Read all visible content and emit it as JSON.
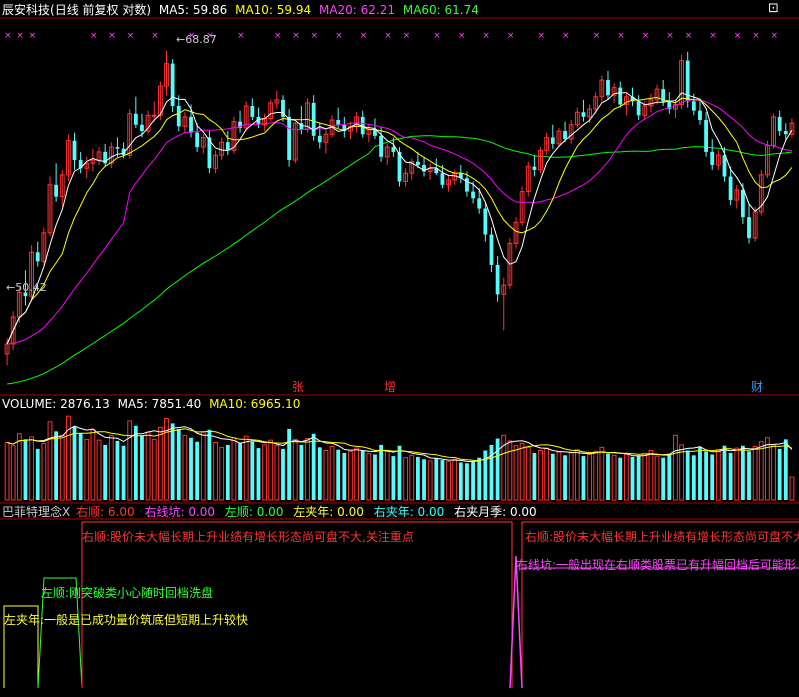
{
  "title_bar": {
    "stock_name": "辰安科技",
    "mode": "(日线 前复权 对数)",
    "ma5": "MA5: 59.86",
    "ma10": "MA10: 59.94",
    "ma20": "MA20: 62.21",
    "ma60": "MA60: 61.74"
  },
  "price_panel": {
    "high_marker": "68.87",
    "low_marker": "50.42",
    "event_markers": [
      {
        "label": "张",
        "color": "#ff3333"
      },
      {
        "label": "增",
        "color": "#ff3333"
      },
      {
        "label": "财",
        "color": "#3399ff"
      }
    ]
  },
  "volume_bar": {
    "volume": "VOLUME: 2876.13",
    "ma5": "MA5: 7851.40",
    "ma10": "MA10: 6965.10"
  },
  "indicator_bar": {
    "name": "巴菲特理念X",
    "items": [
      {
        "label": "右顺: 6.00",
        "color": "#ff3333"
      },
      {
        "label": "右线坑: 0.00",
        "color": "#ff33ff"
      },
      {
        "label": "左顺: 0.00",
        "color": "#33ff33"
      },
      {
        "label": "左夹年: 0.00",
        "color": "#ffff33"
      },
      {
        "label": "右夹年: 0.00",
        "color": "#33ffff"
      },
      {
        "label": "右夹月季: 0.00",
        "color": "#ffffff"
      }
    ]
  },
  "indicator_text": {
    "right_shun_1": "右顺:股价未大幅长期上升业绩有增长形态尚可盘不大,关注重点",
    "right_shun_2": "右顺:股价未大幅长期上升业绩有增长形态尚可盘不大",
    "left_shun": "左顺:刚突破类小心随时回档洗盘",
    "left_jia": "左夹年:一般是已成功量价筑底但短期上升较快",
    "right_pit": "右线坑:一般出现在右顺类股票已有升幅回档后可能形"
  },
  "colors": {
    "up": "#ff3232",
    "down": "#54fcfc",
    "ma5": "#ffffff",
    "ma10": "#ffff00",
    "ma20": "#ff00ff",
    "ma60": "#00ff00",
    "border": "#b00000"
  },
  "chart_data": {
    "type": "candlestick",
    "scale": "log",
    "ylim": [
      49.5,
      71
    ],
    "note_days": 129,
    "ohlc": [
      [
        51.0,
        51.8,
        50.42,
        51.5
      ],
      [
        51.5,
        53.2,
        51.2,
        52.9
      ],
      [
        52.9,
        54.5,
        52.6,
        54.2
      ],
      [
        54.2,
        55.4,
        53.5,
        54.0
      ],
      [
        54.0,
        56.8,
        53.8,
        56.4
      ],
      [
        56.4,
        57.0,
        55.6,
        55.9
      ],
      [
        55.9,
        57.8,
        55.7,
        57.5
      ],
      [
        57.5,
        60.8,
        57.3,
        60.3
      ],
      [
        60.3,
        61.6,
        59.3,
        59.6
      ],
      [
        59.6,
        61.2,
        59.0,
        60.9
      ],
      [
        60.9,
        63.4,
        60.5,
        63.0
      ],
      [
        63.0,
        63.5,
        61.2,
        61.8
      ],
      [
        61.8,
        62.3,
        61.0,
        61.3
      ],
      [
        61.3,
        62.0,
        60.7,
        61.6
      ],
      [
        61.6,
        62.5,
        61.1,
        61.8
      ],
      [
        61.8,
        62.6,
        61.5,
        62.3
      ],
      [
        62.3,
        62.8,
        61.4,
        61.6
      ],
      [
        61.6,
        62.9,
        61.3,
        62.6
      ],
      [
        62.6,
        63.2,
        62.0,
        62.5
      ],
      [
        62.5,
        62.9,
        61.9,
        62.1
      ],
      [
        62.1,
        65.0,
        61.9,
        64.7
      ],
      [
        64.7,
        65.8,
        63.8,
        64.0
      ],
      [
        64.0,
        64.7,
        63.2,
        63.6
      ],
      [
        63.6,
        64.9,
        63.4,
        64.6
      ],
      [
        64.6,
        65.5,
        64.2,
        64.6
      ],
      [
        64.6,
        66.8,
        64.3,
        66.5
      ],
      [
        66.5,
        68.87,
        65.9,
        68.0
      ],
      [
        68.0,
        68.3,
        64.8,
        65.2
      ],
      [
        65.2,
        65.9,
        63.6,
        63.9
      ],
      [
        63.9,
        64.8,
        63.5,
        64.5
      ],
      [
        64.5,
        65.3,
        63.2,
        63.5
      ],
      [
        63.5,
        64.1,
        62.3,
        62.6
      ],
      [
        62.6,
        63.4,
        62.2,
        63.2
      ],
      [
        63.2,
        63.6,
        61.0,
        61.3
      ],
      [
        61.3,
        62.4,
        61.0,
        62.1
      ],
      [
        62.1,
        63.2,
        61.8,
        62.9
      ],
      [
        62.9,
        63.6,
        62.1,
        62.4
      ],
      [
        62.4,
        64.5,
        62.2,
        64.2
      ],
      [
        64.2,
        64.9,
        63.5,
        63.8
      ],
      [
        63.8,
        65.5,
        63.6,
        65.2
      ],
      [
        65.2,
        65.7,
        64.3,
        64.5
      ],
      [
        64.5,
        65.1,
        63.8,
        64.0
      ],
      [
        64.0,
        64.7,
        63.6,
        64.4
      ],
      [
        64.4,
        65.6,
        64.2,
        65.4
      ],
      [
        65.4,
        66.2,
        65.0,
        65.6
      ],
      [
        65.6,
        65.9,
        64.2,
        64.5
      ],
      [
        64.5,
        65.0,
        61.4,
        61.8
      ],
      [
        61.8,
        64.2,
        61.6,
        64.1
      ],
      [
        64.1,
        65.2,
        63.4,
        63.7
      ],
      [
        63.7,
        65.7,
        63.5,
        65.4
      ],
      [
        65.4,
        65.9,
        63.0,
        63.3
      ],
      [
        63.3,
        64.1,
        62.5,
        62.9
      ],
      [
        62.9,
        63.7,
        62.2,
        63.4
      ],
      [
        63.4,
        64.6,
        63.2,
        64.3
      ],
      [
        64.3,
        65.1,
        63.8,
        64.0
      ],
      [
        64.0,
        64.5,
        63.2,
        63.6
      ],
      [
        63.6,
        64.2,
        63.1,
        63.9
      ],
      [
        63.9,
        64.8,
        63.5,
        64.5
      ],
      [
        64.5,
        64.9,
        63.2,
        63.4
      ],
      [
        63.4,
        64.0,
        62.9,
        63.7
      ],
      [
        63.7,
        64.4,
        63.1,
        63.3
      ],
      [
        63.3,
        63.9,
        61.7,
        62.0
      ],
      [
        62.0,
        62.8,
        61.5,
        62.6
      ],
      [
        62.6,
        63.2,
        62.0,
        62.3
      ],
      [
        62.3,
        62.6,
        60.2,
        60.5
      ],
      [
        60.5,
        61.3,
        60.2,
        61.0
      ],
      [
        61.0,
        61.9,
        60.6,
        61.7
      ],
      [
        61.7,
        62.3,
        61.3,
        61.5
      ],
      [
        61.5,
        62.0,
        60.8,
        61.1
      ],
      [
        61.1,
        61.6,
        60.6,
        61.3
      ],
      [
        61.3,
        61.9,
        60.9,
        61.0
      ],
      [
        61.0,
        61.5,
        60.1,
        60.3
      ],
      [
        60.3,
        60.9,
        59.9,
        60.6
      ],
      [
        60.6,
        61.2,
        60.3,
        61.0
      ],
      [
        61.0,
        61.5,
        60.4,
        60.7
      ],
      [
        60.7,
        61.1,
        59.6,
        59.9
      ],
      [
        59.9,
        60.5,
        59.2,
        59.5
      ],
      [
        59.5,
        60.1,
        58.6,
        58.9
      ],
      [
        58.9,
        59.2,
        57.0,
        57.4
      ],
      [
        57.4,
        57.8,
        55.3,
        55.7
      ],
      [
        55.7,
        56.2,
        53.7,
        54.1
      ],
      [
        54.1,
        55.0,
        52.2,
        54.6
      ],
      [
        54.6,
        57.2,
        54.4,
        56.9
      ],
      [
        56.9,
        58.4,
        56.6,
        58.1
      ],
      [
        58.1,
        60.2,
        57.9,
        59.9
      ],
      [
        59.9,
        61.7,
        59.6,
        61.4
      ],
      [
        61.4,
        62.1,
        60.8,
        61.2
      ],
      [
        61.2,
        62.6,
        61.0,
        62.4
      ],
      [
        62.4,
        63.5,
        62.1,
        63.2
      ],
      [
        63.2,
        64.0,
        62.5,
        62.8
      ],
      [
        62.8,
        63.8,
        62.6,
        63.6
      ],
      [
        63.6,
        64.2,
        62.9,
        63.1
      ],
      [
        63.1,
        64.3,
        62.8,
        64.0
      ],
      [
        64.0,
        65.1,
        63.8,
        64.8
      ],
      [
        64.8,
        65.6,
        64.2,
        64.5
      ],
      [
        64.5,
        65.3,
        64.1,
        65.0
      ],
      [
        65.0,
        66.1,
        64.7,
        65.8
      ],
      [
        65.8,
        67.2,
        65.5,
        66.9
      ],
      [
        66.9,
        67.5,
        65.6,
        65.9
      ],
      [
        65.9,
        66.7,
        65.4,
        66.4
      ],
      [
        66.4,
        66.8,
        65.1,
        65.3
      ],
      [
        65.3,
        66.0,
        64.6,
        65.8
      ],
      [
        65.8,
        66.4,
        65.2,
        65.5
      ],
      [
        65.5,
        65.9,
        64.3,
        64.6
      ],
      [
        64.6,
        65.5,
        64.3,
        65.2
      ],
      [
        65.2,
        66.0,
        64.8,
        65.6
      ],
      [
        65.6,
        66.6,
        65.3,
        66.3
      ],
      [
        66.3,
        66.9,
        65.2,
        65.5
      ],
      [
        65.5,
        66.1,
        64.7,
        65.0
      ],
      [
        65.0,
        65.6,
        64.4,
        65.3
      ],
      [
        65.3,
        68.6,
        65.0,
        68.2
      ],
      [
        68.2,
        68.8,
        65.1,
        65.5
      ],
      [
        65.5,
        66.0,
        64.6,
        64.9
      ],
      [
        64.9,
        65.5,
        64.0,
        64.3
      ],
      [
        64.3,
        64.8,
        62.0,
        62.3
      ],
      [
        62.3,
        63.1,
        61.2,
        61.5
      ],
      [
        61.5,
        62.4,
        61.2,
        62.1
      ],
      [
        62.1,
        62.6,
        60.5,
        60.8
      ],
      [
        60.8,
        61.4,
        59.1,
        59.4
      ],
      [
        59.4,
        60.3,
        58.9,
        60.0
      ],
      [
        60.0,
        60.4,
        58.0,
        58.4
      ],
      [
        58.4,
        59.2,
        56.9,
        57.2
      ],
      [
        57.2,
        59.0,
        57.0,
        58.7
      ],
      [
        58.7,
        61.2,
        58.5,
        60.9
      ],
      [
        60.9,
        63.0,
        60.7,
        62.7
      ],
      [
        62.7,
        64.7,
        62.5,
        64.5
      ],
      [
        64.5,
        64.9,
        63.3,
        63.6
      ],
      [
        63.6,
        64.1,
        63.0,
        63.4
      ],
      [
        63.4,
        64.4,
        63.2,
        64.1
      ]
    ],
    "ma60_start": 49.5,
    "volume": [
      7200,
      6800,
      8300,
      7600,
      7900,
      6400,
      7100,
      9800,
      8600,
      8100,
      10500,
      9200,
      8400,
      7600,
      8800,
      7500,
      6900,
      8100,
      7400,
      6800,
      9900,
      9300,
      8100,
      8500,
      7600,
      9100,
      10200,
      9600,
      8900,
      8100,
      7800,
      7300,
      8500,
      8800,
      7200,
      6600,
      6900,
      7800,
      7100,
      8000,
      7300,
      6500,
      6900,
      7500,
      6800,
      6400,
      8900,
      7600,
      6900,
      7700,
      8300,
      6600,
      6200,
      6700,
      6300,
      5900,
      6100,
      6500,
      6200,
      5800,
      5700,
      6900,
      6100,
      5500,
      6800,
      5300,
      5600,
      5400,
      5100,
      4900,
      5200,
      5000,
      4800,
      5100,
      4700,
      4600,
      4900,
      5300,
      6200,
      6900,
      7700,
      8100,
      7400,
      6800,
      7100,
      6600,
      5900,
      6200,
      6500,
      5800,
      6000,
      5600,
      5900,
      6300,
      5500,
      5700,
      6100,
      6600,
      5800,
      5600,
      5300,
      5700,
      5400,
      5600,
      5800,
      6200,
      5500,
      5300,
      5800,
      8100,
      6900,
      6200,
      5600,
      6600,
      6100,
      5700,
      6300,
      6800,
      5900,
      6500,
      6800,
      6100,
      6700,
      7300,
      7800,
      6900,
      6400,
      7600,
      2876
    ]
  }
}
